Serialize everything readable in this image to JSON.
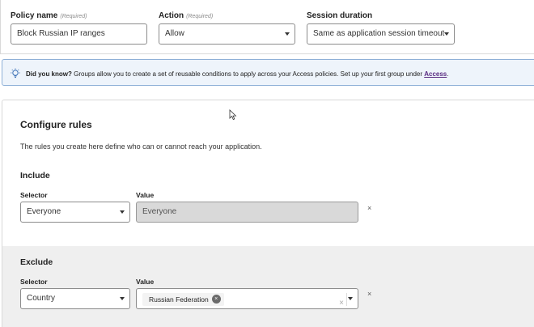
{
  "policy": {
    "name_label": "Policy name",
    "name_required": "(Required)",
    "name_value": "Block Russian IP ranges",
    "action_label": "Action",
    "action_required": "(Required)",
    "action_value": "Allow",
    "session_label": "Session duration",
    "session_value": "Same as application session timeout"
  },
  "banner": {
    "icon": "lightbulb-icon",
    "bold": "Did you know?",
    "text": " Groups allow you to create a set of reusable conditions to apply across your Access policies. Set up your first group under ",
    "link": "Access",
    "end": ".",
    "accent_color": "#5a2d82"
  },
  "rules": {
    "title": "Configure rules",
    "description": "The rules you create here define who can or cannot reach your application.",
    "include": {
      "title": "Include",
      "selector_label": "Selector",
      "selector_value": "Everyone",
      "value_label": "Value",
      "value_value": "Everyone",
      "remove": "×"
    },
    "exclude": {
      "title": "Exclude",
      "selector_label": "Selector",
      "selector_value": "Country",
      "value_label": "Value",
      "chip": "Russian Federation",
      "chip_remove": "×",
      "clear": "×",
      "remove": "×"
    }
  }
}
